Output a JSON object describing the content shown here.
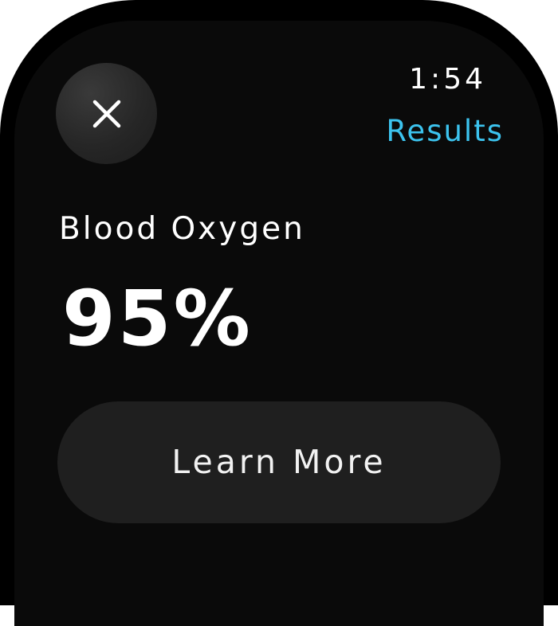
{
  "status_bar": {
    "time": "1:54"
  },
  "header": {
    "title": "Results",
    "title_color": "#3cc3ee",
    "close_icon": "close-icon"
  },
  "metric": {
    "label": "Blood Oxygen",
    "value": "95%"
  },
  "actions": {
    "learn_more_label": "Learn More"
  },
  "colors": {
    "background": "#000000",
    "button_background": "#1f1f1f",
    "text": "#ffffff",
    "accent": "#3cc3ee"
  }
}
